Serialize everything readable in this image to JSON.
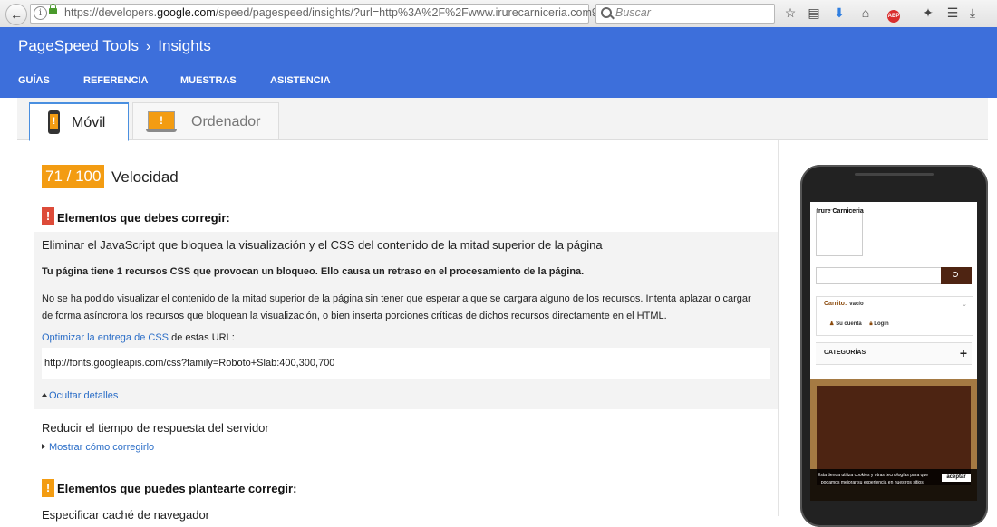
{
  "browser": {
    "url_prefix": "https://developers.",
    "url_domain": "google.com",
    "url_suffix": "/speed/pagespeed/insights/?url=http%3A%2F%2Fwww.irurecarniceria.com9",
    "search_placeholder": "Buscar",
    "adblock_badge": "ABP"
  },
  "header": {
    "crumb_root": "PageSpeed Tools",
    "crumb_separator": "›",
    "crumb_current": "Insights",
    "menu": [
      "GUÍAS",
      "REFERENCIA",
      "MUESTRAS",
      "ASISTENCIA"
    ]
  },
  "tabs": {
    "mobile": "Móvil",
    "desktop": "Ordenador"
  },
  "score": {
    "value": "71 / 100",
    "label": "Velocidad"
  },
  "sections": {
    "must_fix": {
      "heading": "Elementos que debes corregir:",
      "rule_title": "Eliminar el JavaScript que bloquea la visualización y el CSS del contenido de la mitad superior de la página",
      "summary": "Tu página tiene 1 recursos CSS que provocan un bloqueo. Ello causa un retraso en el procesamiento de la página.",
      "description": "No se ha podido visualizar el contenido de la mitad superior de la página sin tener que esperar a que se cargara alguno de los recursos. Intenta aplazar o cargar de forma asíncrona los recursos que bloquean la visualización, o bien inserta porciones críticas de dichos recursos directamente en el HTML.",
      "optimize_link": "Optimizar la entrega de CSS",
      "optimize_suffix": " de estas URL:",
      "resource_url": "http://fonts.googleapis.com/css?family=Roboto+Slab:400,300,700",
      "hide_details": "Ocultar detalles",
      "rule2_title": "Reducir el tiempo de respuesta del servidor",
      "show_fix": "Mostrar cómo corregirlo"
    },
    "consider_fix": {
      "heading": "Elementos que puedes plantearte corregir:",
      "first_item": "Especificar caché de navegador"
    }
  },
  "preview": {
    "site_name": "Irure Carniceria",
    "cart_label": "Carrito:",
    "cart_status": "vacío",
    "account_link": "Su cuenta",
    "login_link": "Login",
    "categories": "CATEGORÍAS",
    "plus": "+",
    "cookie_text": "Esta tienda utiliza cookies y otras tecnologías para que podamos mejorar su experiencia en nuestros sitios.",
    "cookie_button": "aceptar"
  },
  "colors": {
    "header_bg": "#3d6fdb",
    "score_bg": "#f39c12",
    "critical": "#dd4b39",
    "link": "#2a6dc7"
  }
}
